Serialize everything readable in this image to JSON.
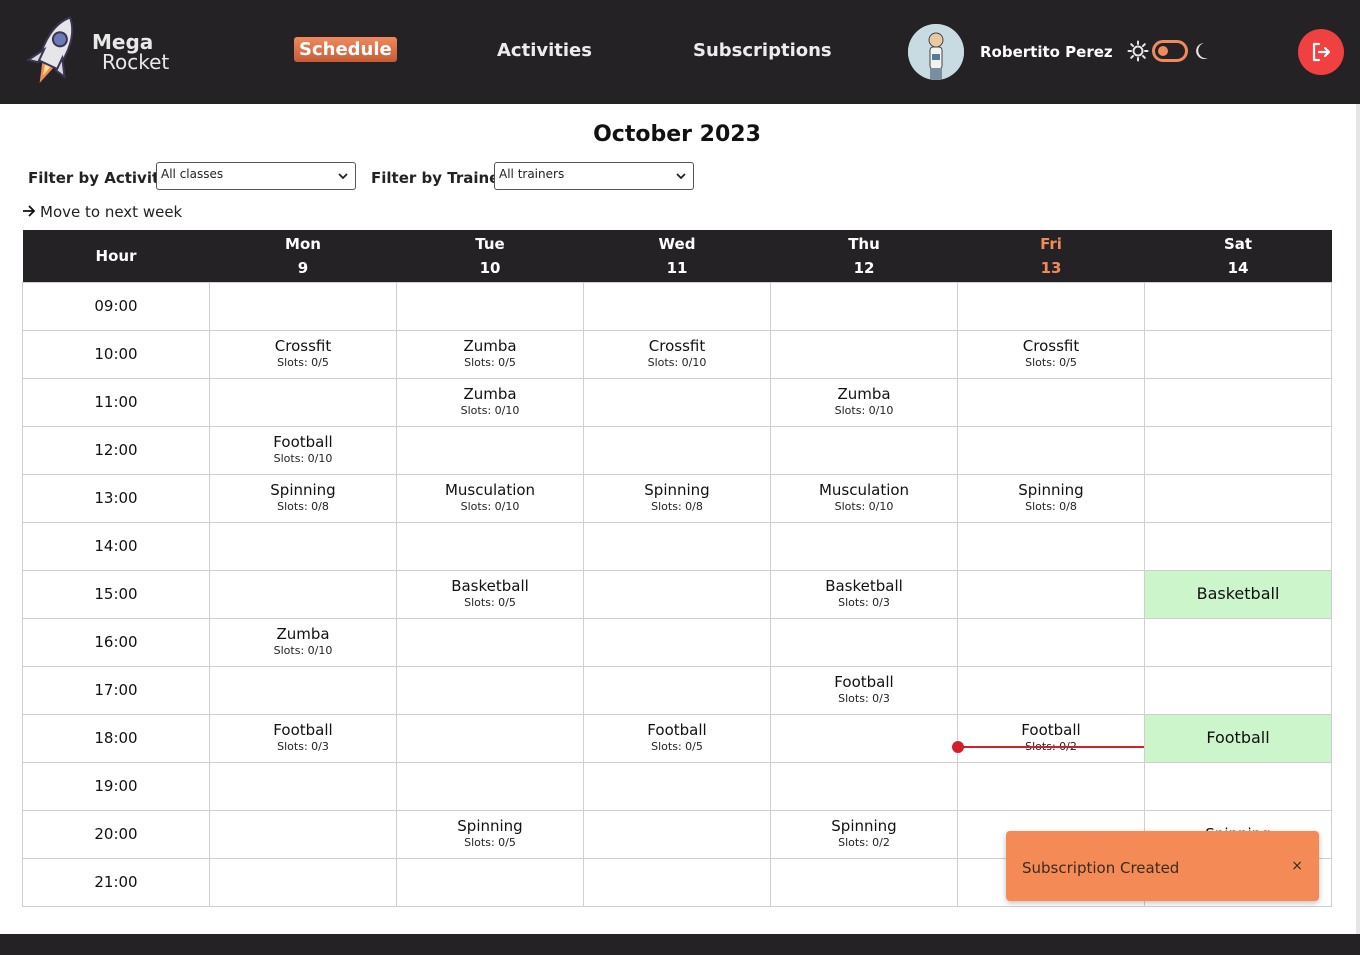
{
  "app": {
    "logo_line1": "Mega",
    "logo_line2": "Rocket"
  },
  "nav": {
    "schedule": "Schedule",
    "activities": "Activities",
    "subscriptions": "Subscriptions"
  },
  "user": {
    "name": "Robertito Perez"
  },
  "icons": {
    "logo": "rocket-icon",
    "theme_light": "sun-icon",
    "theme_toggle": "toggle-switch",
    "theme_dark": "moon-icon",
    "logout": "logout-icon",
    "next_week": "arrow-right-icon"
  },
  "colors": {
    "header_bg": "#252225",
    "accent": "#f08a5d",
    "subscribed_bg": "#cdf5cc",
    "now_line": "#d21f2a",
    "logout_bg": "#f04040",
    "toast_bg": "#f48b56"
  },
  "month_title": "October 2023",
  "filters": {
    "activity_label": "Filter by Activity",
    "activity_value": "All classes",
    "trainer_label": "Filter by Trainer",
    "trainer_value": "All trainers"
  },
  "next_week": "Move to next week",
  "table": {
    "hour_header": "Hour",
    "days": [
      {
        "name": "Mon",
        "date": "9"
      },
      {
        "name": "Tue",
        "date": "10"
      },
      {
        "name": "Wed",
        "date": "11"
      },
      {
        "name": "Thu",
        "date": "12"
      },
      {
        "name": "Fri",
        "date": "13"
      },
      {
        "name": "Sat",
        "date": "14"
      }
    ],
    "rows": [
      {
        "hour": "09:00",
        "cells": [
          null,
          null,
          null,
          null,
          null,
          null
        ]
      },
      {
        "hour": "10:00",
        "cells": [
          {
            "name": "Crossfit",
            "slots": "Slots: 0/5"
          },
          {
            "name": "Zumba",
            "slots": "Slots: 0/5"
          },
          {
            "name": "Crossfit",
            "slots": "Slots: 0/10"
          },
          null,
          {
            "name": "Crossfit",
            "slots": "Slots: 0/5"
          },
          null
        ]
      },
      {
        "hour": "11:00",
        "cells": [
          null,
          {
            "name": "Zumba",
            "slots": "Slots: 0/10"
          },
          null,
          {
            "name": "Zumba",
            "slots": "Slots: 0/10"
          },
          null,
          null
        ]
      },
      {
        "hour": "12:00",
        "cells": [
          {
            "name": "Football",
            "slots": "Slots: 0/10"
          },
          null,
          null,
          null,
          null,
          null
        ]
      },
      {
        "hour": "13:00",
        "cells": [
          {
            "name": "Spinning",
            "slots": "Slots: 0/8"
          },
          {
            "name": "Musculation",
            "slots": "Slots: 0/10"
          },
          {
            "name": "Spinning",
            "slots": "Slots: 0/8"
          },
          {
            "name": "Musculation",
            "slots": "Slots: 0/10"
          },
          {
            "name": "Spinning",
            "slots": "Slots: 0/8"
          },
          null
        ]
      },
      {
        "hour": "14:00",
        "cells": [
          null,
          null,
          null,
          null,
          null,
          null
        ]
      },
      {
        "hour": "15:00",
        "cells": [
          null,
          {
            "name": "Basketball",
            "slots": "Slots: 0/5"
          },
          null,
          {
            "name": "Basketball",
            "slots": "Slots: 0/3"
          },
          null,
          {
            "name": "Basketball",
            "subscribed": true
          }
        ]
      },
      {
        "hour": "16:00",
        "cells": [
          {
            "name": "Zumba",
            "slots": "Slots: 0/10"
          },
          null,
          null,
          null,
          null,
          null
        ]
      },
      {
        "hour": "17:00",
        "cells": [
          null,
          null,
          null,
          {
            "name": "Football",
            "slots": "Slots: 0/3"
          },
          null,
          null
        ]
      },
      {
        "hour": "18:00",
        "cells": [
          {
            "name": "Football",
            "slots": "Slots: 0/3"
          },
          null,
          {
            "name": "Football",
            "slots": "Slots: 0/5"
          },
          null,
          {
            "name": "Football",
            "slots": "Slots: 0/2"
          },
          {
            "name": "Football",
            "subscribed": true
          }
        ]
      },
      {
        "hour": "19:00",
        "cells": [
          null,
          null,
          null,
          null,
          null,
          null
        ]
      },
      {
        "hour": "20:00",
        "cells": [
          null,
          {
            "name": "Spinning",
            "slots": "Slots: 0/5"
          },
          null,
          {
            "name": "Spinning",
            "slots": "Slots: 0/2"
          },
          null,
          {
            "name": "Spinning"
          }
        ]
      },
      {
        "hour": "21:00",
        "cells": [
          null,
          null,
          null,
          null,
          null,
          null
        ]
      }
    ]
  },
  "toast": {
    "message": "Subscription Created",
    "close": "×"
  }
}
